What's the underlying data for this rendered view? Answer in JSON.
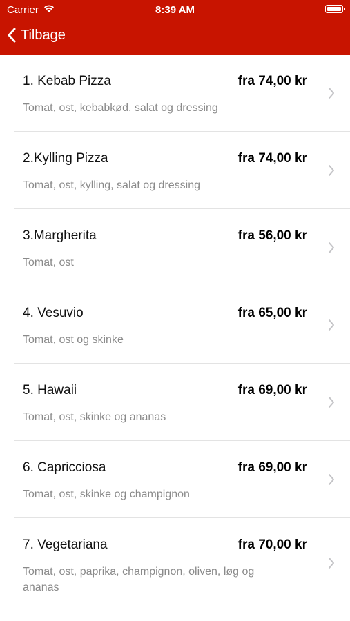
{
  "status_bar": {
    "carrier": "Carrier",
    "time": "8:39 AM"
  },
  "nav": {
    "back_label": "Tilbage"
  },
  "colors": {
    "header": "#c81400",
    "description": "#8a8a8a",
    "separator": "#e3e3e3"
  },
  "icons": [
    "wifi-icon",
    "battery-icon",
    "back-chevron-icon",
    "chevron-right-icon"
  ],
  "items": [
    {
      "name": "1. Kebab Pizza",
      "price": "fra 74,00 kr",
      "description": "Tomat, ost, kebabkød, salat og dressing"
    },
    {
      "name": "2.Kylling Pizza",
      "price": "fra 74,00 kr",
      "description": "Tomat, ost, kylling, salat og dressing"
    },
    {
      "name": "3.Margherita",
      "price": "fra 56,00 kr",
      "description": "Tomat, ost"
    },
    {
      "name": "4. Vesuvio",
      "price": "fra 65,00 kr",
      "description": "Tomat, ost og skinke"
    },
    {
      "name": "5. Hawaii",
      "price": "fra 69,00 kr",
      "description": "Tomat, ost, skinke og ananas"
    },
    {
      "name": "6. Capricciosa",
      "price": "fra 69,00 kr",
      "description": "Tomat, ost, skinke og champignon"
    },
    {
      "name": "7. Vegetariana",
      "price": "fra 70,00 kr",
      "description": "Tomat, ost, paprika, champignon, oliven, løg og ananas"
    }
  ]
}
